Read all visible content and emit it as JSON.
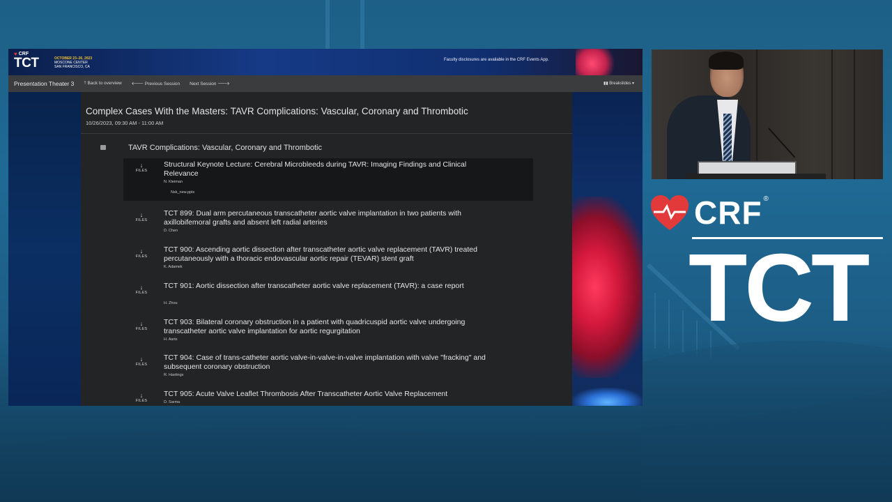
{
  "banner": {
    "crf": "CRF",
    "tct": "TCT",
    "dates": "OCTOBER 23–26, 2023",
    "venue": "MOSCONE CENTER",
    "city": "SAN FRANCISCO, CA",
    "note": "Faculty disclosures are available in the CRF Events App."
  },
  "nav": {
    "brand": "Presentation Theater 3",
    "back": "🡑 Back to overview",
    "prev": "🡐 Previous Session",
    "next": "Next Session 🡒",
    "breakslides": "▮▮ Breakslides ▾"
  },
  "session": {
    "title": "Complex Cases With the Masters: TAVR Complications: Vascular, Coronary and Thrombotic",
    "date": "10/26/2023, 09:30 AM - 11:00 AM",
    "group_title": "TAVR Complications: Vascular, Coronary and Thrombotic"
  },
  "files_label": "FILES",
  "files_arrow": "↓",
  "talks": [
    {
      "title": "Structural Keynote Lecture: Cerebral Microbleeds during TAVR: Imaging Findings and Clinical Relevance",
      "speaker": "N. Kleiman",
      "file": "Nsk_new.pptx"
    },
    {
      "title": "TCT 899: Dual arm percutaneous transcatheter aortic valve implantation in two patients with axillobifemoral grafts and absent left radial arteries",
      "speaker": "D. Chen"
    },
    {
      "title": "TCT 900: Ascending aortic dissection after transcatheter aortic valve replacement (TAVR) treated percutaneously with a thoracic endovascular aortic repair (TEVAR) stent graft",
      "speaker": "K. Adamek"
    },
    {
      "title": "TCT 901: Aortic dissection after transcatheter aortic valve replacement (TAVR): a case report",
      "speaker": "H. Zhou"
    },
    {
      "title": "TCT 903: Bilateral coronary obstruction in a patient with quadricuspid aortic valve undergoing transcatheter aortic valve implantation for aortic regurgitation",
      "speaker": "H. Aarts"
    },
    {
      "title": "TCT 904: Case of trans-catheter aortic valve-in-valve-in-valve implantation with valve \"fracking\" and subsequent coronary obstruction",
      "speaker": "R. Hastings"
    },
    {
      "title": "TCT 905: Acute Valve Leaflet Thrombosis After Transcatheter Aortic Valve Replacement",
      "speaker": "D. Sarma"
    }
  ],
  "branding": {
    "crf": "CRF",
    "reg": "®",
    "tct": "TCT"
  },
  "colors": {
    "background": "#1f6a95",
    "content_bg": "#222425",
    "navbar": "#3a3c3e",
    "accent_red": "#e23a3a"
  }
}
